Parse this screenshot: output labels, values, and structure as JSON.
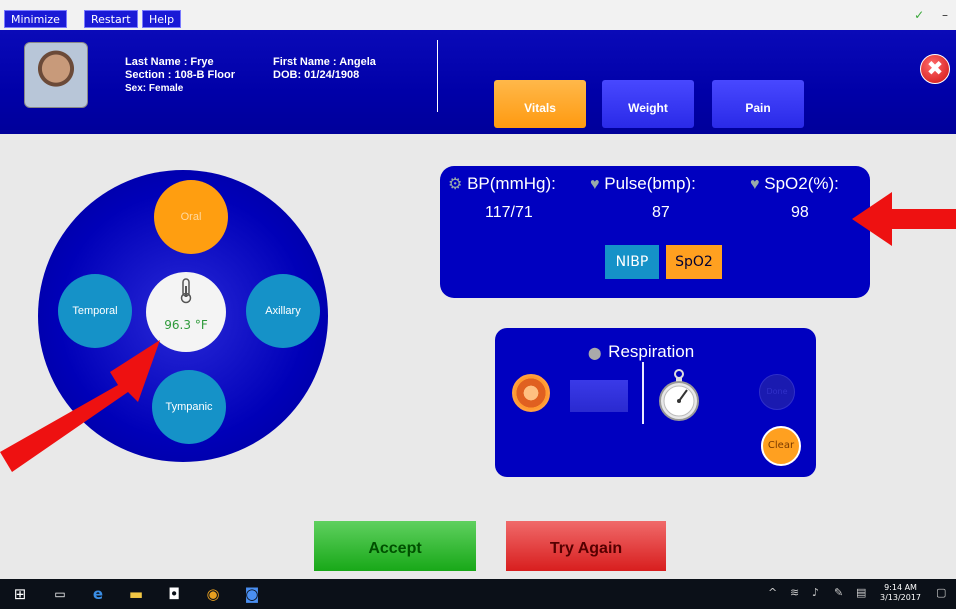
{
  "menu": {
    "minimize": "Minimize",
    "restart": "Restart",
    "help": "Help"
  },
  "window_controls": {
    "check": "✓",
    "minimize": "–"
  },
  "patient": {
    "last_name": "Last Name : Frye",
    "section": "Section : 108-B Floor",
    "sex": "Sex: Female",
    "first_name": "First Name : Angela",
    "dob": "DOB: 01/24/1908"
  },
  "tabs": {
    "vitals": "Vitals",
    "weight": "Weight",
    "pain": "Pain",
    "active": "vitals"
  },
  "close_glyph": "✖",
  "temperature": {
    "sites": {
      "oral": "Oral",
      "temporal": "Temporal",
      "axillary": "Axillary",
      "tympanic": "Tympanic"
    },
    "selected_site": "oral",
    "value": "96.3 °F"
  },
  "vitals": {
    "bp_label": "BP(mmHg):",
    "bp_value": "117/71",
    "pulse_label": "Pulse(bmp):",
    "pulse_value": "87",
    "spo2_label": "SpO2(%):",
    "spo2_value": "98",
    "nibp_button": "NIBP",
    "spo2_button": "SpO2"
  },
  "respiration": {
    "title": "Respiration",
    "done": "Done",
    "clear": "Clear"
  },
  "actions": {
    "accept": "Accept",
    "try_again": "Try Again"
  },
  "taskbar": {
    "time": "9:14 AM",
    "date": "3/13/2017",
    "icons": [
      "windows-start-icon",
      "task-view-icon",
      "edge-icon",
      "file-explorer-icon",
      "store-icon",
      "chrome-icon",
      "app-icon"
    ]
  },
  "colors": {
    "header": "#0000a8",
    "accent_orange": "#ff9e10",
    "site_blue": "#1592c8",
    "accept_green": "#18a818",
    "try_again_red": "#d81e1e",
    "arrow_red": "#ee1111"
  }
}
